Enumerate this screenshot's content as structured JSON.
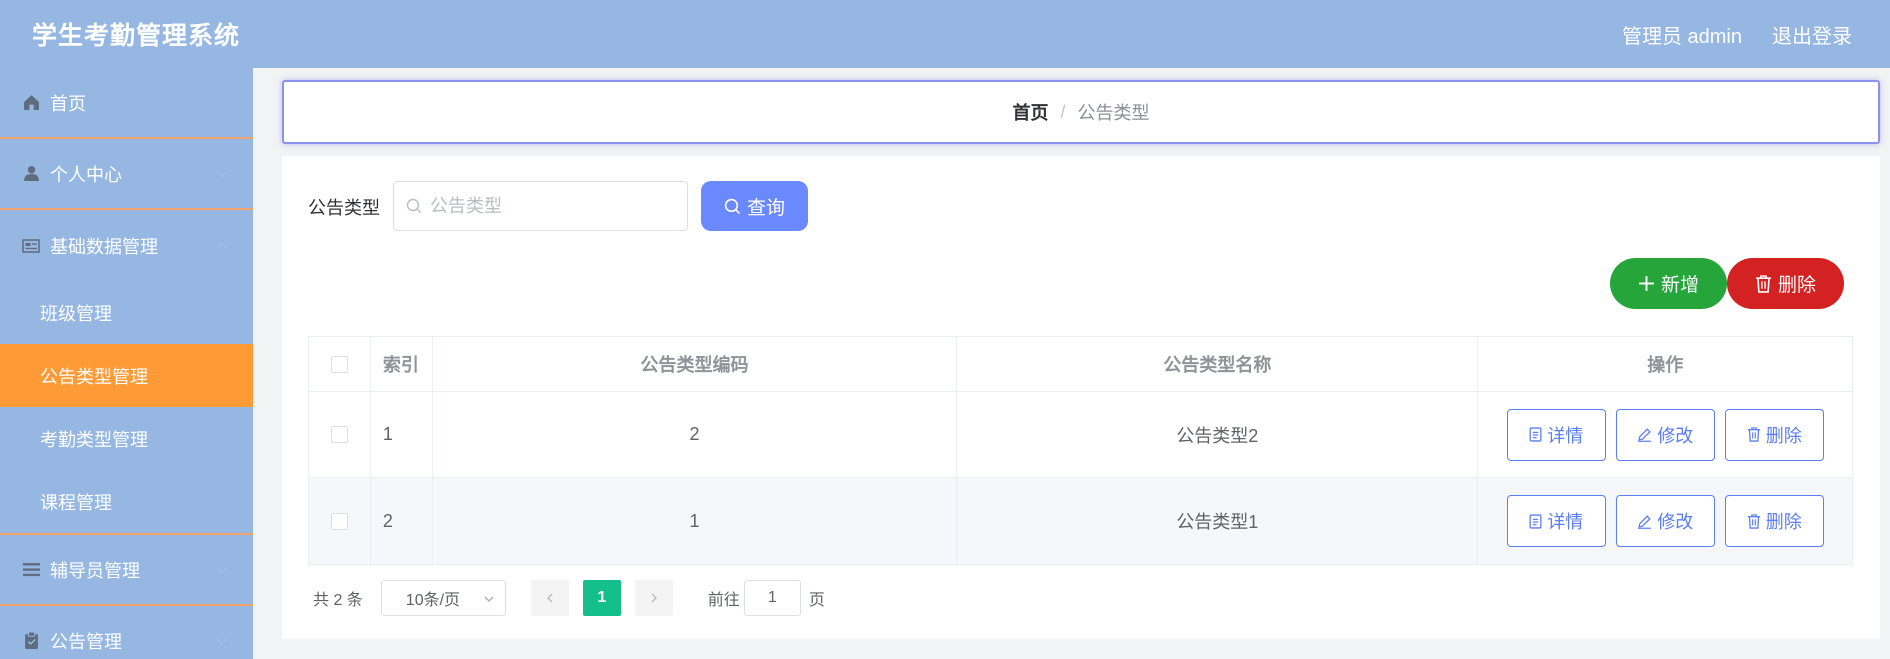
{
  "header": {
    "title": "学生考勤管理系统",
    "user": "管理员 admin",
    "logout": "退出登录"
  },
  "sidebar": {
    "items": [
      {
        "label": "首页",
        "icon": "home-icon"
      },
      {
        "label": "个人中心",
        "icon": "user-icon",
        "expanded": false
      },
      {
        "label": "基础数据管理",
        "icon": "data-icon",
        "expanded": true
      },
      {
        "label": "辅导员管理",
        "icon": "list-icon",
        "expanded": false
      },
      {
        "label": "公告管理",
        "icon": "clipboard-icon",
        "expanded": false
      }
    ],
    "sub_items": [
      {
        "label": "班级管理"
      },
      {
        "label": "公告类型管理",
        "active": true
      },
      {
        "label": "考勤类型管理"
      },
      {
        "label": "课程管理"
      }
    ]
  },
  "breadcrumb": {
    "home": "首页",
    "separator": "/",
    "current": "公告类型"
  },
  "search": {
    "label": "公告类型",
    "placeholder": "公告类型",
    "query_button": "查询"
  },
  "actions": {
    "add": "新增",
    "delete": "删除"
  },
  "table": {
    "columns": [
      "索引",
      "公告类型编码",
      "公告类型名称",
      "操作"
    ],
    "rows": [
      {
        "index": "1",
        "code": "2",
        "name": "公告类型2"
      },
      {
        "index": "2",
        "code": "1",
        "name": "公告类型1"
      }
    ],
    "op_labels": {
      "detail": "详情",
      "edit": "修改",
      "delete": "删除"
    }
  },
  "pagination": {
    "total": "共 2 条",
    "page_size": "10条/页",
    "current_page": "1",
    "goto_prefix": "前往",
    "goto_value": "1",
    "goto_suffix": "页"
  },
  "colors": {
    "header_bg": "#96b7e2",
    "active_menu": "#ff9b37",
    "query_btn": "#6b89ff",
    "add_btn": "#25a53a",
    "delete_btn": "#d42121",
    "page_active": "#13c08b"
  }
}
